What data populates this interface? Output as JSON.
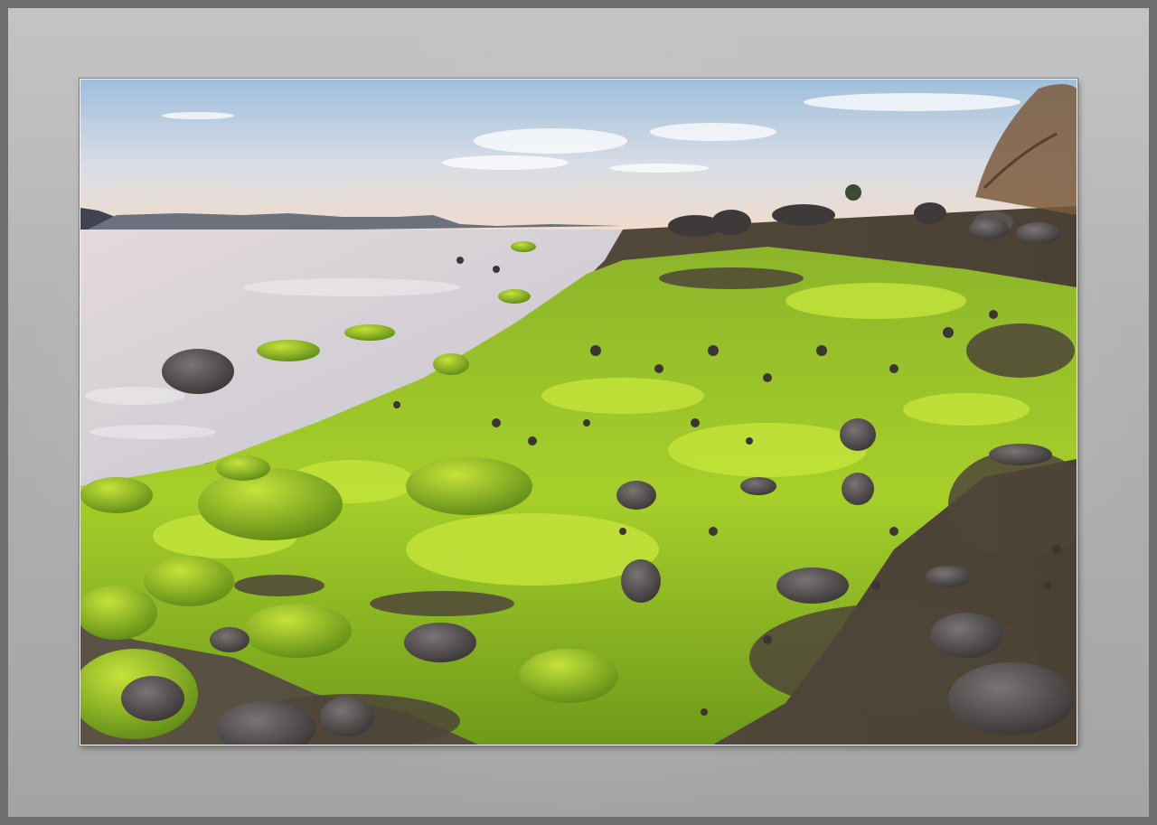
{
  "frame": {
    "border_color": "#6f6f6f",
    "mat_color": "#b3b3b3"
  },
  "photo": {
    "subject": "rocky-shoreline-with-green-seaweed",
    "palette": {
      "sky_top": "#9fbfdc",
      "sky_horizon": "#f2dccb",
      "water": "#d9d6db",
      "seaweed_bright": "#b6dc2a",
      "seaweed_dark": "#6f9a1a",
      "rock": "#4a4646",
      "mountains": "#5f6470"
    }
  }
}
